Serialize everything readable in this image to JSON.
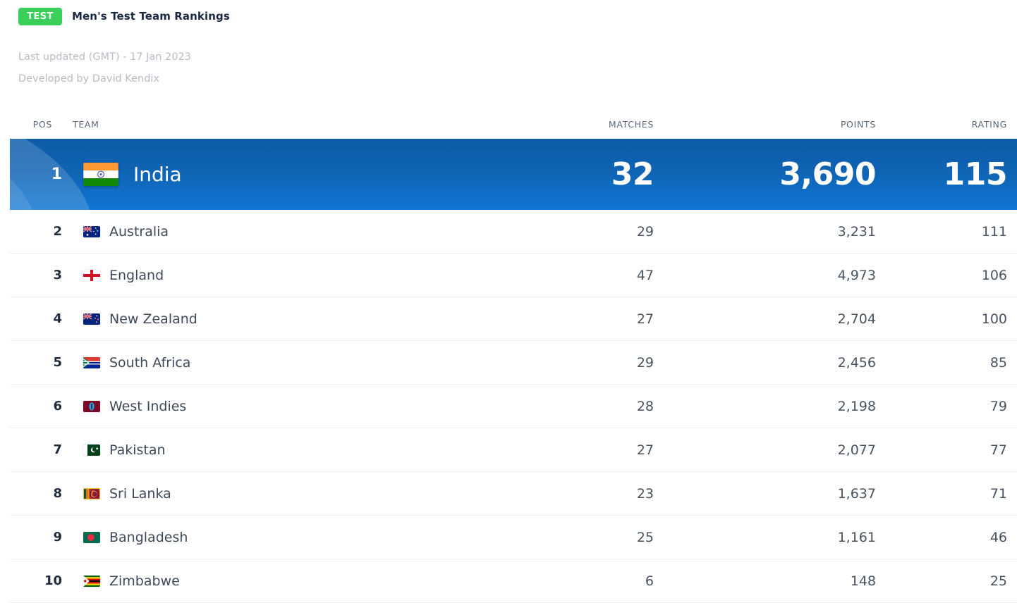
{
  "header": {
    "badge": "TEST",
    "title": "Men's Test Team Rankings",
    "last_updated": "Last updated (GMT) - 17 Jan 2023",
    "developed_by": "Developed by David Kendix",
    "badge_color": "#3ace5a",
    "leader_color": "#0f63b3"
  },
  "table": {
    "columns": {
      "pos": "POS",
      "team": "TEAM",
      "matches": "MATCHES",
      "points": "POINTS",
      "rating": "RATING"
    },
    "rows": [
      {
        "pos": "1",
        "team": "India",
        "flag": "flag-india",
        "matches": "32",
        "points": "3,690",
        "rating": "115"
      },
      {
        "pos": "2",
        "team": "Australia",
        "flag": "flag-australia",
        "matches": "29",
        "points": "3,231",
        "rating": "111"
      },
      {
        "pos": "3",
        "team": "England",
        "flag": "flag-england",
        "matches": "47",
        "points": "4,973",
        "rating": "106"
      },
      {
        "pos": "4",
        "team": "New Zealand",
        "flag": "flag-new-zealand",
        "matches": "27",
        "points": "2,704",
        "rating": "100"
      },
      {
        "pos": "5",
        "team": "South Africa",
        "flag": "flag-south-africa",
        "matches": "29",
        "points": "2,456",
        "rating": "85"
      },
      {
        "pos": "6",
        "team": "West Indies",
        "flag": "flag-west-indies",
        "matches": "28",
        "points": "2,198",
        "rating": "79"
      },
      {
        "pos": "7",
        "team": "Pakistan",
        "flag": "flag-pakistan",
        "matches": "27",
        "points": "2,077",
        "rating": "77"
      },
      {
        "pos": "8",
        "team": "Sri Lanka",
        "flag": "flag-sri-lanka",
        "matches": "23",
        "points": "1,637",
        "rating": "71"
      },
      {
        "pos": "9",
        "team": "Bangladesh",
        "flag": "flag-bangladesh",
        "matches": "25",
        "points": "1,161",
        "rating": "46"
      },
      {
        "pos": "10",
        "team": "Zimbabwe",
        "flag": "flag-zimbabwe",
        "matches": "6",
        "points": "148",
        "rating": "25"
      }
    ]
  }
}
